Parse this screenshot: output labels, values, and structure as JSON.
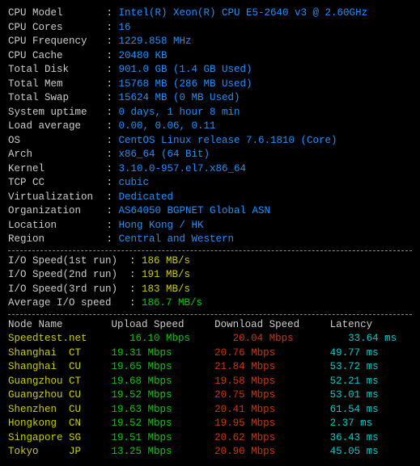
{
  "specs": [
    {
      "label": "CPU Model",
      "value": "Intel(R) Xeon(R) CPU E5-2640 v3 @ 2.60GHz"
    },
    {
      "label": "CPU Cores",
      "value": "16"
    },
    {
      "label": "CPU Frequency",
      "value": "1229.858 MHz"
    },
    {
      "label": "CPU Cache",
      "value": "20480 KB"
    },
    {
      "label": "Total Disk",
      "value": "901.0 GB (1.4 GB Used)"
    },
    {
      "label": "Total Mem",
      "value": "15768 MB (286 MB Used)"
    },
    {
      "label": "Total Swap",
      "value": "15624 MB (0 MB Used)"
    },
    {
      "label": "System uptime",
      "value": "0 days, 1 hour 8 min"
    },
    {
      "label": "Load average",
      "value": "0.00, 0.06, 0.11"
    },
    {
      "label": "OS",
      "value": "CentOS Linux release 7.6.1810 (Core)"
    },
    {
      "label": "Arch",
      "value": "x86_64 (64 Bit)"
    },
    {
      "label": "Kernel",
      "value": "3.10.0-957.el7.x86_64"
    },
    {
      "label": "TCP CC",
      "value": "cubic"
    },
    {
      "label": "Virtualization",
      "value": "Dedicated"
    },
    {
      "label": "Organization",
      "value": "AS64050 BGPNET Global ASN"
    },
    {
      "label": "Location",
      "value": "Hong Kong / HK"
    },
    {
      "label": "Region",
      "value": "Central and Western"
    }
  ],
  "io": [
    {
      "label": "I/O Speed(1st run)",
      "value": "186 MB/s",
      "color": "yellow"
    },
    {
      "label": "I/O Speed(2nd run)",
      "value": "191 MB/s",
      "color": "yellow"
    },
    {
      "label": "I/O Speed(3rd run)",
      "value": "183 MB/s",
      "color": "yellow"
    },
    {
      "label": "Average I/O speed",
      "value": "186.7 MB/s",
      "color": "green"
    }
  ],
  "speedtest": {
    "headers": {
      "node": "Node Name",
      "up": "Upload Speed",
      "down": "Download Speed",
      "lat": "Latency"
    },
    "rows": [
      {
        "node": "Speedtest.net",
        "cc": "",
        "up": "16.10 Mbps",
        "down": "20.04 Mbps",
        "lat": "33.64 ms"
      },
      {
        "node": "Shanghai",
        "cc": "CT",
        "up": "19.31 Mbps",
        "down": "20.76 Mbps",
        "lat": "49.77 ms"
      },
      {
        "node": "Shanghai",
        "cc": "CU",
        "up": "19.65 Mbps",
        "down": "21.84 Mbps",
        "lat": "53.72 ms"
      },
      {
        "node": "Guangzhou",
        "cc": "CT",
        "up": "19.68 Mbps",
        "down": "19.58 Mbps",
        "lat": "52.21 ms"
      },
      {
        "node": "Guangzhou",
        "cc": "CU",
        "up": "19.52 Mbps",
        "down": "20.75 Mbps",
        "lat": "53.01 ms"
      },
      {
        "node": "Shenzhen",
        "cc": "CU",
        "up": "19.63 Mbps",
        "down": "20.41 Mbps",
        "lat": "61.54 ms"
      },
      {
        "node": "Hongkong",
        "cc": "CN",
        "up": "19.52 Mbps",
        "down": "19.95 Mbps",
        "lat": "2.37 ms"
      },
      {
        "node": "Singapore",
        "cc": "SG",
        "up": "19.51 Mbps",
        "down": "20.62 Mbps",
        "lat": "36.43 ms"
      },
      {
        "node": "Tokyo",
        "cc": "JP",
        "up": "13.25 Mbps",
        "down": "20.90 Mbps",
        "lat": "45.05 ms"
      }
    ]
  }
}
